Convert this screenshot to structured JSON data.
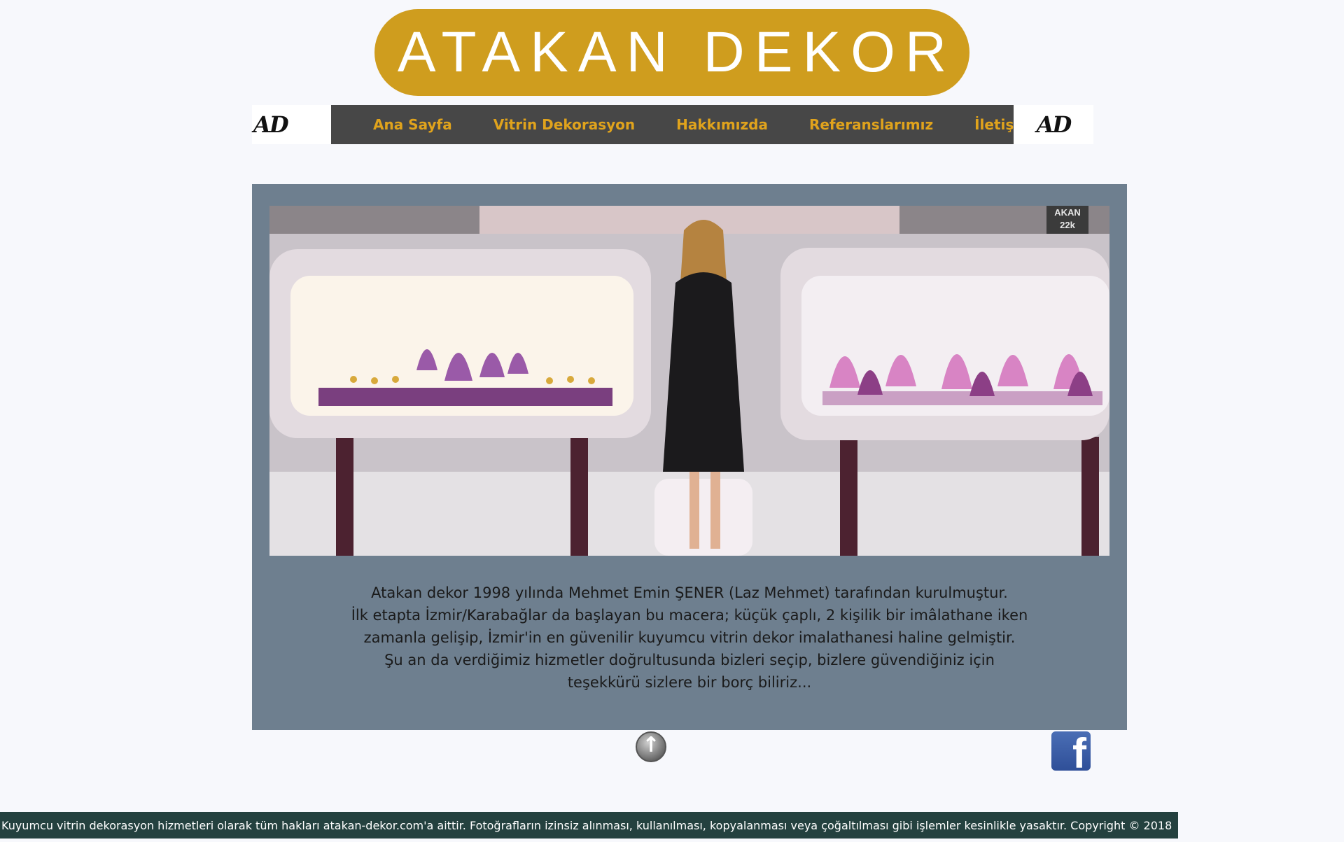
{
  "logo": {
    "text": "ATAKAN DEKOR"
  },
  "side_marks": {
    "left": "AD",
    "right": "AD"
  },
  "nav": {
    "items": [
      {
        "label": "Ana Sayfa"
      },
      {
        "label": "Vitrin Dekorasyon"
      },
      {
        "label": "Hakkımızda"
      },
      {
        "label": "Referanslarımız"
      },
      {
        "label": "İletişim"
      }
    ]
  },
  "about": {
    "lines": [
      "Atakan dekor 1998 yılında Mehmet Emin ŞENER (Laz Mehmet) tarafından kurulmuştur.",
      "İlk etapta İzmir/Karabağlar da başlayan bu macera; küçük çaplı, 2 kişilik bir imâlathane iken",
      "zamanla gelişip, İzmir'in en güvenilir kuyumcu vitrin dekor imalathanesi haline gelmiştir.",
      "Şu an da verdiğimiz hizmetler doğrultusunda bizleri seçip, bizlere güvendiğiniz için",
      "teşekkürü sizlere bir borç biliriz..."
    ]
  },
  "icons": {
    "scroll_top": "up-arrow-icon",
    "social": "facebook-icon"
  },
  "facebook": {
    "glyph": "f"
  },
  "up_arrow": {
    "glyph": "↑"
  },
  "photo": {
    "sign_text": "AKAN 22k"
  },
  "footer": {
    "text": "Kuyumcu vitrin dekorasyon hizmetleri olarak tüm hakları atakan-dekor.com'a aittir. Fotoğrafların izinsiz alınması, kullanılması, kopyalanması veya çoğaltılması gibi işlemler kesinlikle yasaktır. Copyright © 2018"
  },
  "colors": {
    "page_bg": "#f7f8fc",
    "logo_bg": "#cf9d1e",
    "nav_bg": "#474747",
    "nav_text": "#e0a31c",
    "panel_bg": "#6e7f8f",
    "footer_bg": "#24413f"
  }
}
